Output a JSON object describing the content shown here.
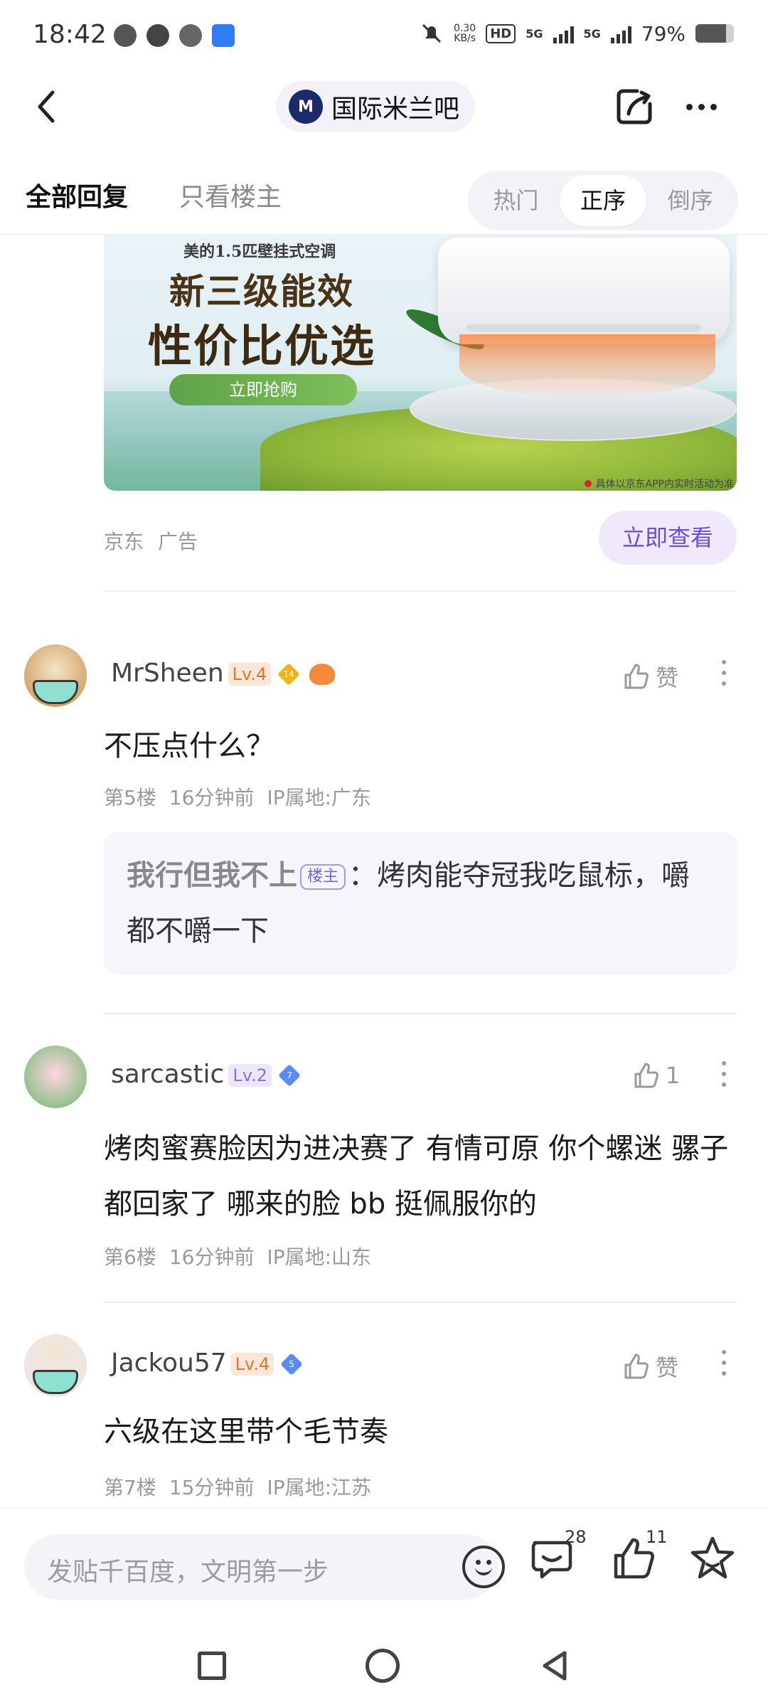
{
  "status_bar": {
    "time": "18:42",
    "net_speed_value": "0.30",
    "net_speed_unit": "KB/s",
    "hd_label": "HD",
    "signal1": "5G",
    "signal2": "5G",
    "battery": "79%",
    "battery_level": 0.79
  },
  "header": {
    "title": "国际米兰吧",
    "logo_text": "M"
  },
  "tabs": {
    "all_replies": "全部回复",
    "op_only": "只看楼主",
    "sort_options": [
      "热门",
      "正序",
      "倒序"
    ],
    "sort_selected": "正序"
  },
  "ad": {
    "small_title": "美的1.5匹壁挂式空调",
    "headline1": "新三级能效",
    "headline2": "性价比优选",
    "cta": "立即抢购",
    "note": "具体以京东APP内实时活动为准",
    "source": "京东",
    "tag": "广告",
    "view_button": "立即查看"
  },
  "posts": [
    {
      "username": "MrSheen",
      "level": "Lv.4",
      "gem_number": "14",
      "like_label": "赞",
      "content": "不压点什么？",
      "floor": "第5楼",
      "time": "16分钟前",
      "ip": "IP属地:广东",
      "reply": {
        "name": "我行但我不上",
        "badge": "楼主",
        "separator": "：",
        "text": "烤肉能夺冠我吃鼠标，嚼都不嚼一下"
      }
    },
    {
      "username": "sarcastic",
      "level": "Lv.2",
      "gem_number": "7",
      "like_label": "1",
      "content": "烤肉蜜赛脸因为进决赛了 有情可原 你个螺迷 骡子都回家了 哪来的脸 bb 挺佩服你的",
      "floor": "第6楼",
      "time": "16分钟前",
      "ip": "IP属地:山东"
    },
    {
      "username": "Jackou57",
      "level": "Lv.4",
      "gem_number": "5",
      "like_label": "赞",
      "content": "六级在这里带个毛节奏",
      "floor": "第7楼",
      "time": "15分钟前",
      "ip": "IP属地:江苏"
    }
  ],
  "bottom_bar": {
    "placeholder": "发贴千百度，文明第一步",
    "comment_count": "28",
    "like_count": "11"
  },
  "colors": {
    "accent": "#6a4fd6",
    "accent_bg": "#efe9fb",
    "muted": "#9a9a9a"
  }
}
